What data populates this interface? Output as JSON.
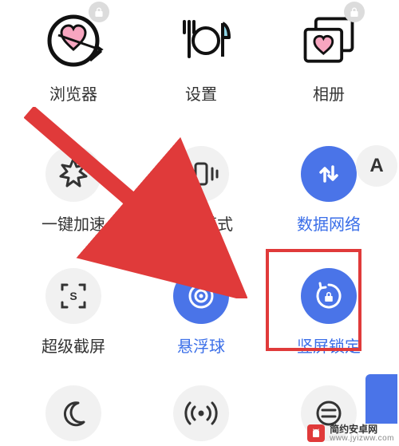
{
  "apps": {
    "browser": {
      "label": "浏览器",
      "locked": true
    },
    "settings": {
      "label": "设置",
      "locked": false
    },
    "gallery": {
      "label": "相册",
      "locked": true
    }
  },
  "toggles": {
    "boost": {
      "label": "一键加速",
      "active": false
    },
    "vibrate": {
      "label": "振动模式",
      "active": false
    },
    "data": {
      "label": "数据网络",
      "active": true
    },
    "superShot": {
      "label": "超级截屏",
      "active": false
    },
    "floatBall": {
      "label": "悬浮球",
      "active": true
    },
    "portraitLock": {
      "label": "竖屏锁定",
      "active": true
    },
    "dnd": {
      "active": false
    },
    "hotspot": {
      "active": false
    },
    "more": {
      "active": false
    }
  },
  "sideBadge": "A",
  "watermark": {
    "title": "简约安卓网",
    "url": "www.jyizww.com"
  },
  "colors": {
    "accent": "#4a74e8",
    "highlight": "#e03a3a"
  }
}
